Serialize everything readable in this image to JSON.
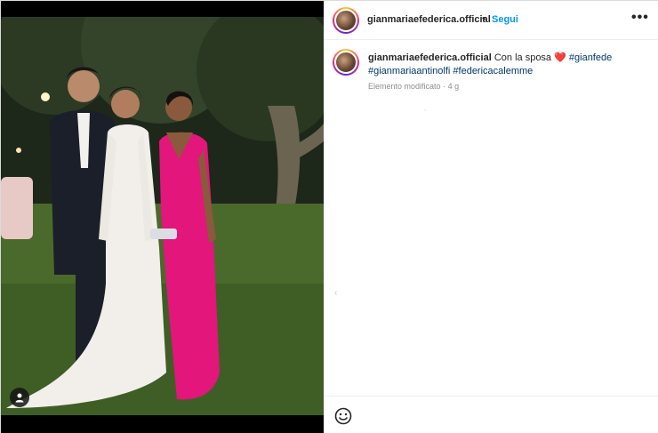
{
  "post": {
    "author": "gianmariaefederica.official",
    "separator": "•",
    "follow_label": "Segui",
    "more_icon": "more-options-icon",
    "caption": {
      "author": "gianmariaefederica.official",
      "text": "Con la sposa",
      "emoji": "❤️",
      "hashtags": [
        "#gianfede",
        "#gianmariaantinolfi",
        "#federicacalemme"
      ],
      "edited_label": "Elemento modificato",
      "time_sep": "·",
      "age": "4 g"
    },
    "faint_marks": [
      ",",
      "‹"
    ],
    "icons": {
      "tag": "user-tag-icon",
      "emoji": "emoji-smile-icon"
    },
    "colors": {
      "link": "#0095f6",
      "hashtag": "#00376b",
      "meta": "#8e8e8e",
      "heart": "#c8102e"
    }
  }
}
